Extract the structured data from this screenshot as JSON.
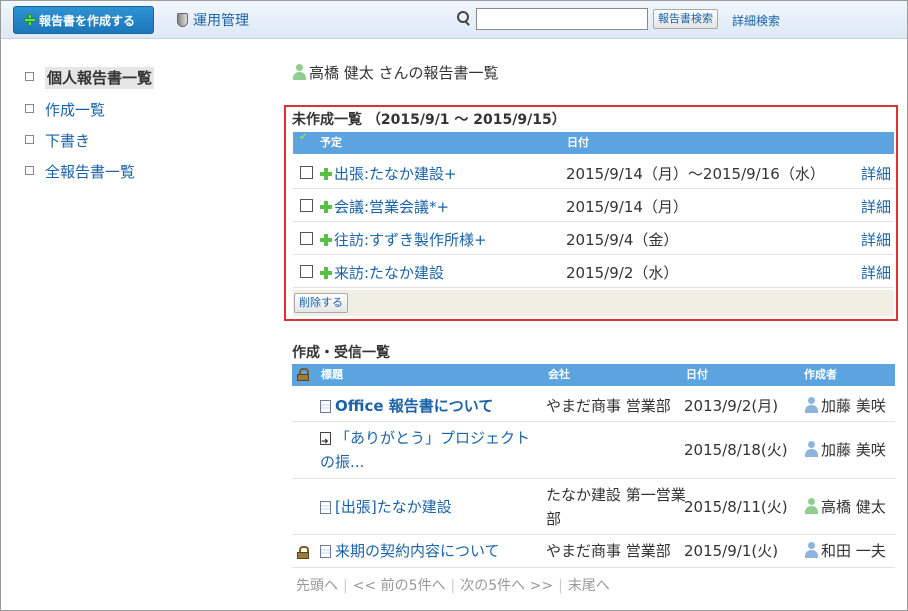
{
  "topbar": {
    "create_button": "報告書を作成する",
    "admin_link": "運用管理",
    "search_value": "",
    "search_button": "報告書検索",
    "advanced_search": "詳細検索"
  },
  "sidebar": {
    "items": [
      {
        "label": "個人報告書一覧",
        "active": true
      },
      {
        "label": "作成一覧",
        "active": false
      },
      {
        "label": "下書き",
        "active": false
      },
      {
        "label": "全報告書一覧",
        "active": false
      }
    ]
  },
  "main": {
    "title": "高橋 健太 さんの報告書一覧",
    "uncreated": {
      "heading": "未作成一覧 （2015/9/1 ～ 2015/9/15）",
      "col_plan": "予定",
      "col_date": "日付",
      "rows": [
        {
          "title": "出張:たなか建設+",
          "date": "2015/9/14（月）～2015/9/16（水）",
          "detail": "詳細"
        },
        {
          "title": "会議:営業会議*+",
          "date": "2015/9/14（月）",
          "detail": "詳細"
        },
        {
          "title": "往訪:すずき製作所様+",
          "date": "2015/9/4（金）",
          "detail": "詳細"
        },
        {
          "title": "来訪:たなか建設",
          "date": "2015/9/2（水）",
          "detail": "詳細"
        }
      ],
      "delete_button": "削除する"
    },
    "created": {
      "heading": "作成・受信一覧",
      "col_title": "標題",
      "col_company": "会社",
      "col_date": "日付",
      "col_author": "作成者",
      "rows": [
        {
          "title": "Office 報告書について",
          "company": "やまだ商事 営業部",
          "date": "2013/9/2(月)",
          "author": "加藤 美咲",
          "icon": "document-icon",
          "locked": false
        },
        {
          "title": "「ありがとう」プロジェクトの振...",
          "company": "",
          "date": "2015/8/18(火)",
          "author": "加藤 美咲",
          "icon": "received-document-icon",
          "locked": false
        },
        {
          "title": "[出張]たなか建設",
          "company": "たなか建設 第一営業部",
          "date": "2015/8/11(火)",
          "author": "高橋 健太",
          "icon": "document-icon",
          "locked": false
        },
        {
          "title": "来期の契約内容について",
          "company": "やまだ商事 営業部",
          "date": "2015/9/1(火)",
          "author": "和田 一夫",
          "icon": "document-icon",
          "locked": true
        }
      ]
    },
    "pager": {
      "first": "先頭へ",
      "prev": "<< 前の5件へ",
      "next": "次の5件へ >>",
      "last": "末尾へ"
    }
  },
  "colors": {
    "header_blue": "#5ba4df",
    "link_blue": "#1a63a8",
    "highlight_red": "#e03131",
    "create_button": "#1b76b8"
  }
}
